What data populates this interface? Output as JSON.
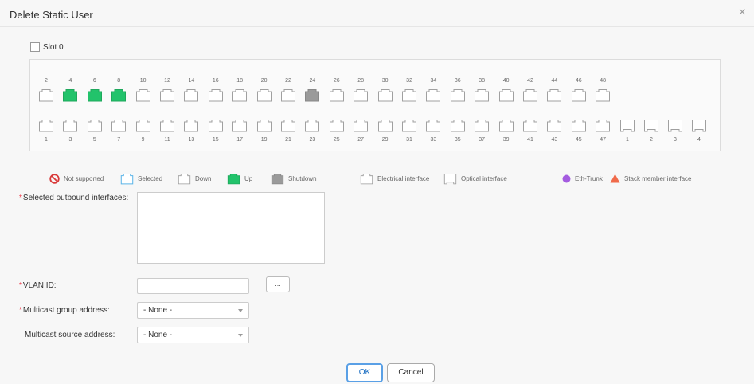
{
  "dialog": {
    "title": "Delete Static User",
    "close": "×"
  },
  "slot": {
    "label": "Slot 0",
    "checked": false
  },
  "ports": {
    "top_numbers": [
      "2",
      "4",
      "6",
      "8",
      "10",
      "12",
      "14",
      "16",
      "18",
      "20",
      "22",
      "24",
      "26",
      "28",
      "30",
      "32",
      "34",
      "36",
      "38",
      "40",
      "42",
      "44",
      "46",
      "48"
    ],
    "top_states": [
      "down",
      "up",
      "up",
      "up",
      "down",
      "down",
      "down",
      "down",
      "down",
      "down",
      "down",
      "shutdown",
      "down",
      "down",
      "down",
      "down",
      "down",
      "down",
      "down",
      "down",
      "down",
      "down",
      "down",
      "down"
    ],
    "bottom_numbers": [
      "1",
      "3",
      "5",
      "7",
      "9",
      "11",
      "13",
      "15",
      "17",
      "19",
      "21",
      "23",
      "25",
      "27",
      "29",
      "31",
      "33",
      "35",
      "37",
      "39",
      "41",
      "43",
      "45",
      "47"
    ],
    "bottom_states": [
      "down",
      "down",
      "down",
      "down",
      "down",
      "down",
      "down",
      "down",
      "down",
      "down",
      "down",
      "down",
      "down",
      "down",
      "down",
      "down",
      "down",
      "down",
      "down",
      "down",
      "down",
      "down",
      "down",
      "down"
    ],
    "optical_numbers": [
      "1",
      "2",
      "3",
      "4"
    ]
  },
  "legend": {
    "not_supported": "Not supported",
    "selected": "Selected",
    "down": "Down",
    "up": "Up",
    "shutdown": "Shutdown",
    "electrical": "Electrical interface",
    "optical": "Optical interface",
    "eth_trunk": "Eth-Trunk",
    "stack": "Stack member interface"
  },
  "form": {
    "required_mark": "*",
    "outbound_label": "Selected outbound interfaces:",
    "outbound_value": "",
    "vlan_label": "VLAN ID:",
    "vlan_value": "",
    "vlan_browse": "...",
    "group_label": "Multicast group address:",
    "group_value": "- None -",
    "source_label": "Multicast source address:",
    "source_value": "- None -"
  },
  "buttons": {
    "ok": "OK",
    "cancel": "Cancel"
  },
  "colors": {
    "up": "#22c36b",
    "shutdown": "#9a9a9a",
    "down": "#ffffff",
    "selected_border": "#5ab4e8",
    "not_supported": "#d93a3a",
    "eth_trunk": "#a45ce0",
    "stack": "#f06a4a"
  }
}
